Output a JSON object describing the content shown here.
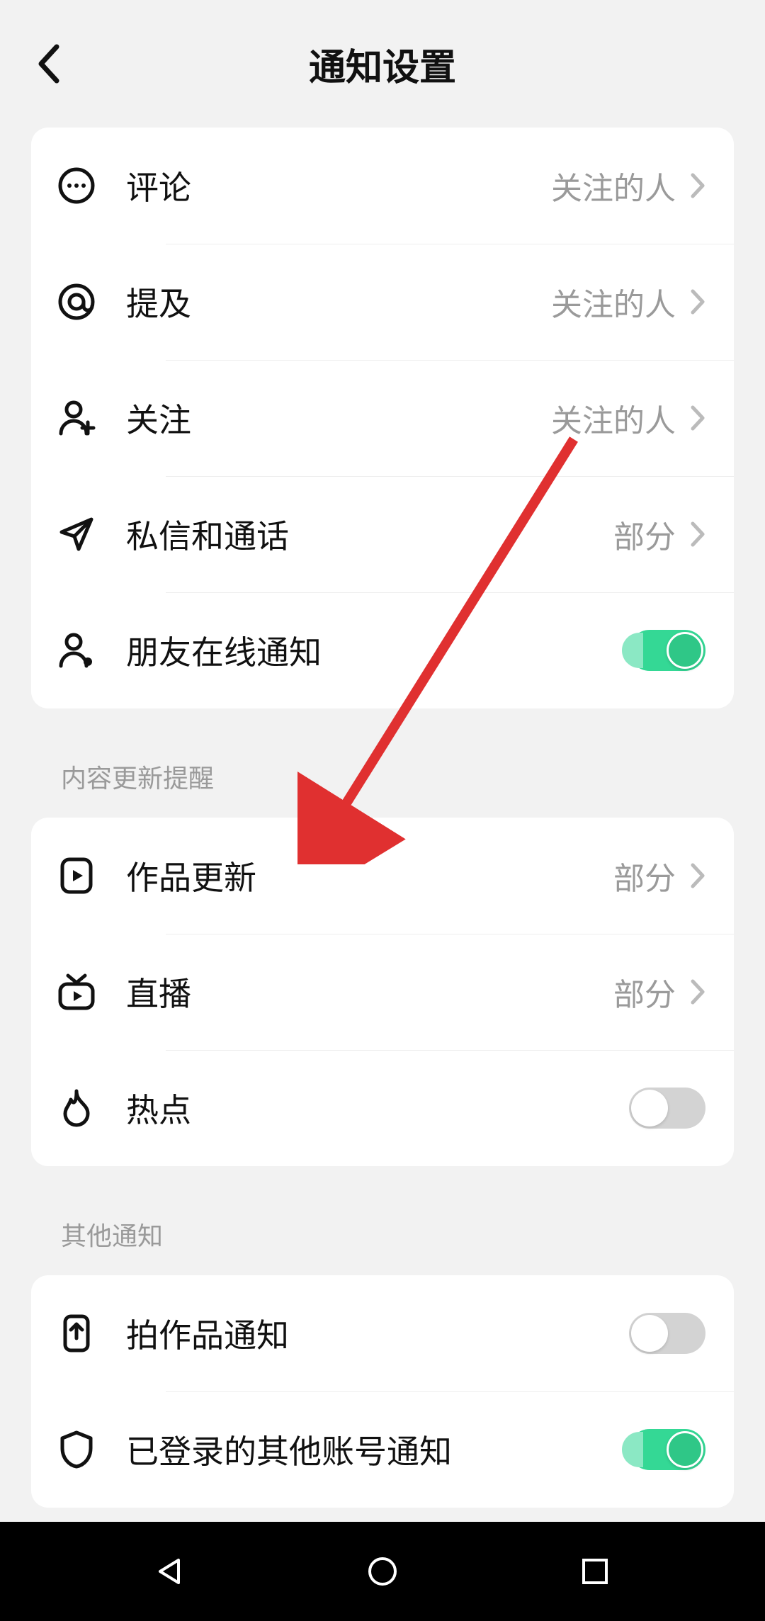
{
  "header": {
    "title": "通知设置"
  },
  "group1": {
    "items": [
      {
        "label": "评论",
        "value": "关注的人"
      },
      {
        "label": "提及",
        "value": "关注的人"
      },
      {
        "label": "关注",
        "value": "关注的人"
      },
      {
        "label": "私信和通话",
        "value": "部分"
      },
      {
        "label": "朋友在线通知"
      }
    ]
  },
  "section2_title": "内容更新提醒",
  "group2": {
    "items": [
      {
        "label": "作品更新",
        "value": "部分"
      },
      {
        "label": "直播",
        "value": "部分"
      },
      {
        "label": "热点"
      }
    ]
  },
  "section3_title": "其他通知",
  "group3": {
    "items": [
      {
        "label": "拍作品通知"
      },
      {
        "label": "已登录的其他账号通知"
      }
    ]
  }
}
